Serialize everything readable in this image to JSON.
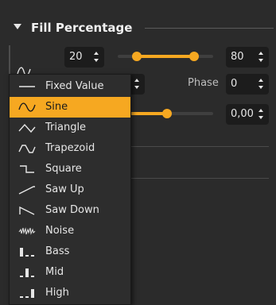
{
  "section": {
    "title": "Fill Percentage"
  },
  "range": {
    "min_value": "20",
    "max_value": "80",
    "slider_low_pct": 0.2,
    "slider_high_pct": 0.8
  },
  "wave": {
    "offset_value": "",
    "phase_label": "Phase",
    "phase_value": "0",
    "amount_value": "0,00"
  },
  "colors": {
    "accent": "#f6a821",
    "panel": "#2b2b2b",
    "field": "#1c1c1c"
  },
  "menu": {
    "selected": "Sine",
    "items": [
      {
        "label": "Fixed Value",
        "icon": "fixed-value-icon"
      },
      {
        "label": "Sine",
        "icon": "sine-icon"
      },
      {
        "label": "Triangle",
        "icon": "triangle-icon"
      },
      {
        "label": "Trapezoid",
        "icon": "trapezoid-icon"
      },
      {
        "label": "Square",
        "icon": "square-icon"
      },
      {
        "label": "Saw Up",
        "icon": "saw-up-icon"
      },
      {
        "label": "Saw Down",
        "icon": "saw-down-icon"
      },
      {
        "label": "Noise",
        "icon": "noise-icon"
      },
      {
        "label": "Bass",
        "icon": "bass-icon"
      },
      {
        "label": "Mid",
        "icon": "mid-icon"
      },
      {
        "label": "High",
        "icon": "high-icon"
      }
    ]
  }
}
